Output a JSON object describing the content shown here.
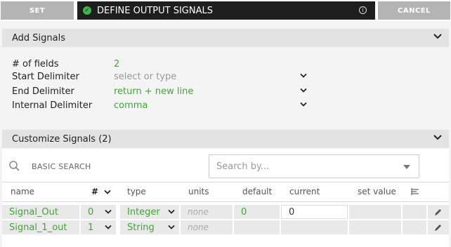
{
  "header": {
    "set_label": "SET",
    "title": "DEFINE OUTPUT SIGNALS",
    "info_glyph": "i",
    "cancel_label": "CANCEL"
  },
  "add_signals": {
    "title": "Add Signals",
    "fields": [
      {
        "label": "# of fields",
        "value": "2"
      },
      {
        "label": "Start Delimiter",
        "value": "select or type"
      },
      {
        "label": "End Delimiter",
        "value": "return + new line"
      },
      {
        "label": "Internal Delimiter",
        "value": "comma"
      }
    ]
  },
  "customize": {
    "title": "Customize Signals (2)",
    "basic_search": "BASIC SEARCH",
    "search_placeholder": "Search by...",
    "columns": [
      "name",
      "#",
      "type",
      "units",
      "default",
      "current",
      "set value"
    ],
    "rows": [
      {
        "name": "Signal_Out",
        "num": "0",
        "type": "Integer",
        "units": "none",
        "default": "0",
        "current": "0",
        "set_value": ""
      },
      {
        "name": "Signal_1_out",
        "num": "1",
        "type": "String",
        "units": "none",
        "default": "",
        "current": "",
        "set_value": ""
      }
    ]
  },
  "colors": {
    "accent_green": "#3fa535",
    "title_bar": "#1e1e1e",
    "button_grey": "#b4b4b4"
  }
}
